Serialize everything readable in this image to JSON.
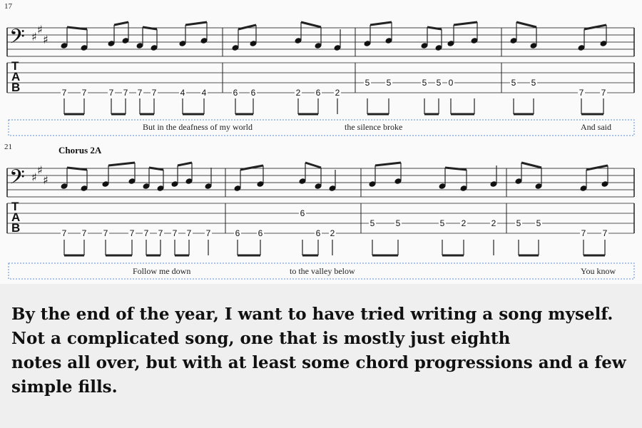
{
  "systems": [
    {
      "measure_number": "17",
      "section_label": "",
      "lyrics": [
        "But in the deafness of my world",
        "the silence broke",
        "And said"
      ],
      "tab_numbers": [
        [
          "7",
          "7",
          "7",
          "7",
          "7",
          "7",
          "4",
          "4"
        ],
        [
          "6",
          "6",
          "2",
          "6",
          "2"
        ],
        [
          "5",
          "5",
          "5",
          "5",
          "0"
        ],
        [
          "5",
          "5",
          "7",
          "7"
        ]
      ]
    },
    {
      "measure_number": "21",
      "section_label": "Chorus 2A",
      "lyrics": [
        "Follow me down",
        "to the valley below",
        "You know"
      ],
      "tab_numbers": [
        [
          "7",
          "7",
          "7",
          "7",
          "7",
          "7",
          "7",
          "7",
          "7"
        ],
        [
          "6",
          "6",
          "6",
          "6",
          "2"
        ],
        [
          "5",
          "5",
          "5",
          "2",
          "2"
        ],
        [
          "5",
          "5",
          "7",
          "7"
        ]
      ]
    }
  ],
  "tab_clef": [
    "T",
    "A",
    "B"
  ],
  "caption": [
    "By the end of the year, I want to have tried writing a song myself.",
    "Not a complicated song, one that is mostly just eighth",
    "notes all over, but with at least some chord progressions and a few",
    "simple fills."
  ]
}
